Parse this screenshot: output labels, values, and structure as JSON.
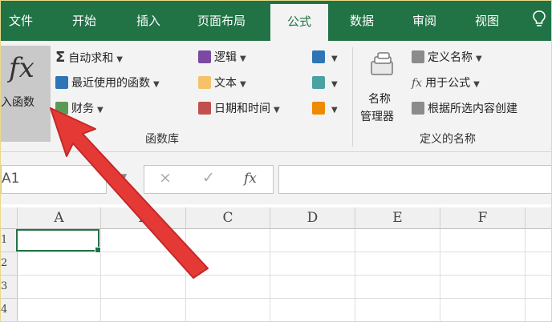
{
  "tabs": [
    "文件",
    "开始",
    "插入",
    "页面布局",
    "公式",
    "数据",
    "审阅",
    "视图"
  ],
  "active_tab": "公式",
  "ribbon": {
    "insert_function": {
      "glyph": "fx",
      "label": "入函数"
    },
    "col1": [
      "自动求和",
      "最近使用的函数",
      "财务"
    ],
    "col2": [
      "逻辑",
      "文本",
      "日期和时间"
    ],
    "group1_label": "函数库",
    "name_manager": [
      "名称",
      "管理器"
    ],
    "defined": [
      "定义名称",
      "用于公式",
      "根据所选内容创建"
    ],
    "group2_label": "定义的名称"
  },
  "formula_bar": {
    "name_box": "A1",
    "cancel": "×",
    "enter": "✓",
    "fx": "fx"
  },
  "grid": {
    "columns": [
      "A",
      "B",
      "C",
      "D",
      "E",
      "F"
    ],
    "rows": [
      "1",
      "2",
      "3",
      "4"
    ]
  },
  "colors": {
    "accent": "#217346",
    "arrow": "#e53935"
  }
}
